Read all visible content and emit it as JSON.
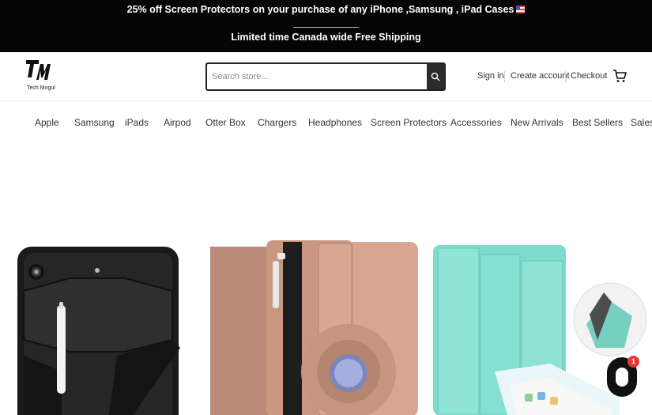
{
  "announcement": {
    "line1": "25% off Screen Protectors on your purchase of any iPhone ,Samsung , iPad Cases",
    "line2": "Limited time Canada wide Free Shipping"
  },
  "brand": {
    "logo_text": "Tech Mogul"
  },
  "search": {
    "placeholder": "Search store..."
  },
  "account": {
    "sign_in": "Sign in",
    "create_account": "Create account",
    "checkout": "Checkout"
  },
  "cart": {
    "badge_count": "1"
  },
  "nav": {
    "items": [
      {
        "label": "Apple"
      },
      {
        "label": "Samsung"
      },
      {
        "label": "iPads"
      },
      {
        "label": "Airpod"
      },
      {
        "label": "Otter Box"
      },
      {
        "label": "Chargers"
      },
      {
        "label": "Headphones"
      },
      {
        "label": "Screen Protectors"
      },
      {
        "label": "Accessories"
      },
      {
        "label": "New Arrivals"
      },
      {
        "label": "Best Sellers"
      },
      {
        "label": "Sales"
      }
    ]
  },
  "products": [
    {
      "icon": "black-rugged-ipad-case-image",
      "color": "#1c1c1c"
    },
    {
      "icon": "rose-gold-rotating-ipad-case-image",
      "color": "#d4a48a"
    },
    {
      "icon": "mint-smart-cover-ipad-case-image",
      "color": "#7fe0d0"
    }
  ],
  "colors": {
    "announcement_bg": "#050505",
    "text": "#333333",
    "badge": "#e53935"
  }
}
